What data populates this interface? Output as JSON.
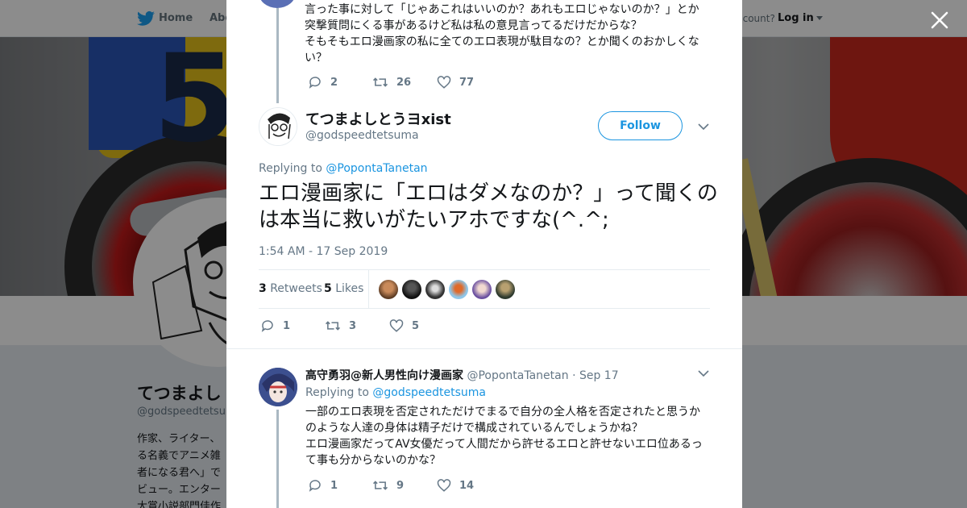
{
  "background": {
    "nav": {
      "home": "Home",
      "about": "Abo",
      "account": "ccount?",
      "login": "Log in"
    },
    "profile": {
      "name": "てつまよし",
      "handle": "@godspeedtetsum",
      "bio": "作家、ライター、\nる名義でアニメ雑\n者になる君へ」で\nビュー。エンター\n大賞小説部門佳作"
    }
  },
  "modal": {
    "prev_tweet": {
      "text": "言った事に対して「じゃあこれはいいのか？あれもエロじゃないのか？」とか突撃質問にくる事があるけど私は私の意見言ってるだけだからな？\nそもそもエロ漫画家の私に全てのエロ表現が駄目なの？とか聞くのおかしくない？",
      "replies": "2",
      "retweets": "26",
      "likes": "77"
    },
    "main_tweet": {
      "name": "てつまよしとうヨxist",
      "handle": "@godspeedtetsuma",
      "follow": "Follow",
      "replying_prefix": "Replying to",
      "replying_to": "@PopontaTanetan",
      "text": "エロ漫画家に「エロはダメなのか？」って聞くのは本当に救いがたいアホですな(^.^;",
      "time": "1:54 AM - 17 Sep 2019",
      "retweet_count": "3",
      "retweet_label": "Retweets",
      "like_count": "5",
      "like_label": "Likes",
      "replies": "1",
      "retweets": "3",
      "likes": "5"
    },
    "reply_tweet": {
      "name": "高守勇羽@新人男性向け漫画家",
      "handle": "@PopontaTanetan",
      "dot": "·",
      "date": "Sep 17",
      "replying_prefix": "Replying to",
      "replying_to": "@godspeedtetsuma",
      "text": "一部のエロ表現を否定されただけでまるで自分の全人格を否定されたと思うかのような人達の身体は精子だけで構成されているんでしょうかね？\nエロ漫画家だってAV女優だって人間だから許せるエロと許せないエロ位あるって事も分からないのかな？",
      "replies": "1",
      "retweets": "9",
      "likes": "14"
    }
  },
  "colors": {
    "link": "#1b95e0",
    "muted": "#657786",
    "line": "#aab8c2"
  },
  "icons": [
    "twitter-bird-icon",
    "close-icon",
    "reply-icon",
    "retweet-icon",
    "like-icon",
    "chevron-down-icon"
  ]
}
